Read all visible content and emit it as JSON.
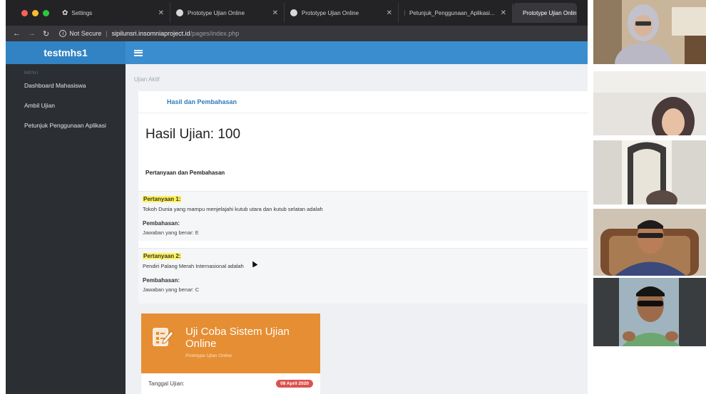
{
  "browser": {
    "tabs": [
      {
        "label": "Settings",
        "icon": "gear-icon"
      },
      {
        "label": "Prototype Ujian Online",
        "icon": "globe-icon"
      },
      {
        "label": "Prototype Ujian Online",
        "icon": "globe-icon"
      },
      {
        "label": "Petunjuk_Penggunaan_Aplikasi...",
        "icon": "globe-icon"
      },
      {
        "label": "Prototype Ujian Onlin",
        "icon": "globe-icon",
        "active": true
      }
    ],
    "security_label": "Not Secure",
    "url_host": "sipilunsri.insomniaproject.id",
    "url_path": "/pages/index.php"
  },
  "app": {
    "brand": "testmhs1",
    "sidebar": {
      "header": "MENU",
      "items": [
        "Dashboard Mahasiswa",
        "Ambil Ujian",
        "Petunjuk Penggunaan Aplikasi"
      ]
    },
    "breadcrumb": "Ujian Aktif",
    "result_tab": "Hasil dan Pembahasan",
    "score": "Hasil Ujian: 100",
    "qa_title": "Pertanyaan dan Pembahasan",
    "questions": [
      {
        "label": "Pertanyaan 1:",
        "text": "Tokoh Dunia yang mampu menjelajahi kutub utara dan kutub selatan adalah",
        "discussion_label": "Pembahasan:",
        "answer": "Jawaban yang benar: E"
      },
      {
        "label": "Pertanyaan 2:",
        "text": "Pendiri Palang Merah Internasional adalah",
        "discussion_label": "Pembahasan:",
        "answer": "Jawaban yang benar: C"
      }
    ],
    "exam_card": {
      "title": "Uji Coba Sistem Ujian Online",
      "subtitle": "Prototype Ujian Online",
      "date_label": "Tanggal Ujian:",
      "date_value": "08 April 2020"
    }
  },
  "colors": {
    "brand_blue": "#3183c4",
    "topbar_blue": "#3a8ed0",
    "sidebar": "#2b2f33",
    "exam_orange": "#e68e33",
    "badge_red": "#d9534f",
    "highlight": "#fff35a"
  }
}
